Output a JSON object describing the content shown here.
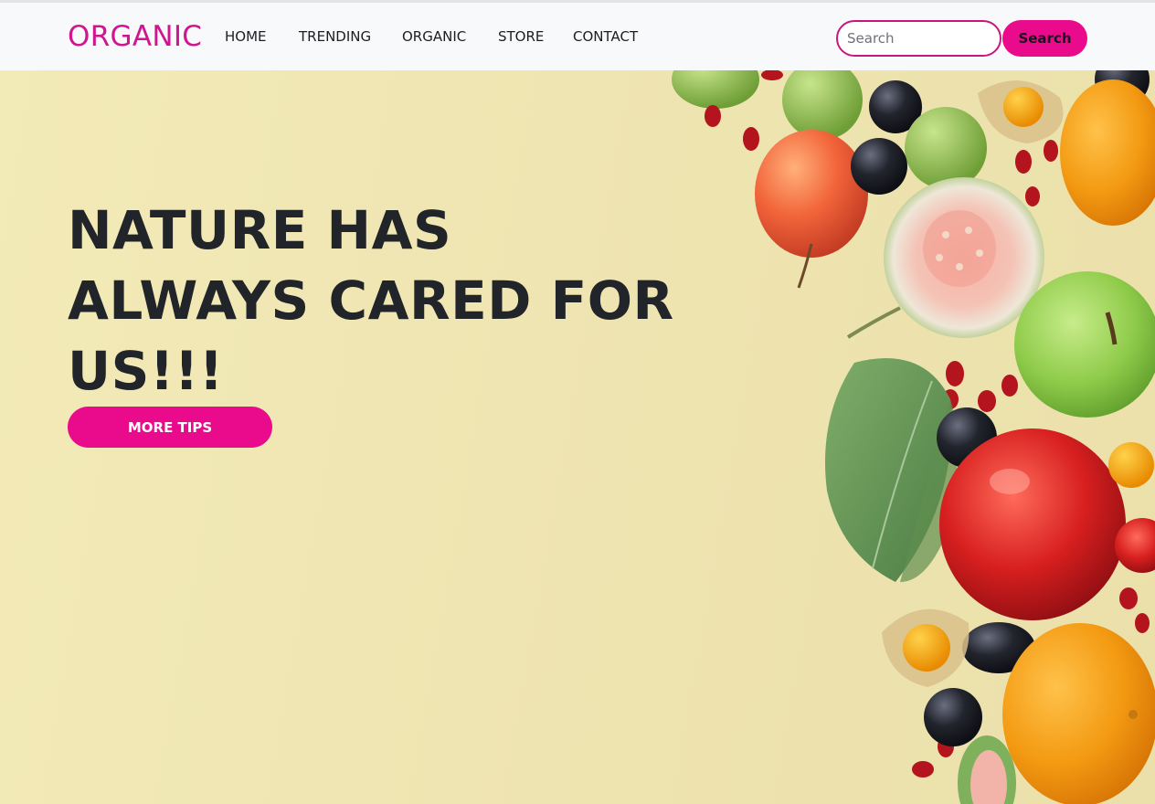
{
  "header": {
    "brand": "ORGANIC",
    "nav": [
      {
        "label": "HOME"
      },
      {
        "label": "TRENDING"
      },
      {
        "label": "ORGANIC"
      },
      {
        "label": "STORE"
      },
      {
        "label": "CONTACT"
      }
    ],
    "search": {
      "placeholder": "Search",
      "value": "",
      "button_label": "Search"
    }
  },
  "hero": {
    "headline": "NATURE HAS ALWAYS CARED FOR US!!!",
    "cta_label": "MORE TIPS",
    "image_subject": "fresh fruits"
  },
  "colors": {
    "brand": "#d11591",
    "accent": "#ea0b8c",
    "headline_text": "#212428",
    "header_background": "#f8f9fb",
    "hero_background": "#f0e6b4"
  }
}
